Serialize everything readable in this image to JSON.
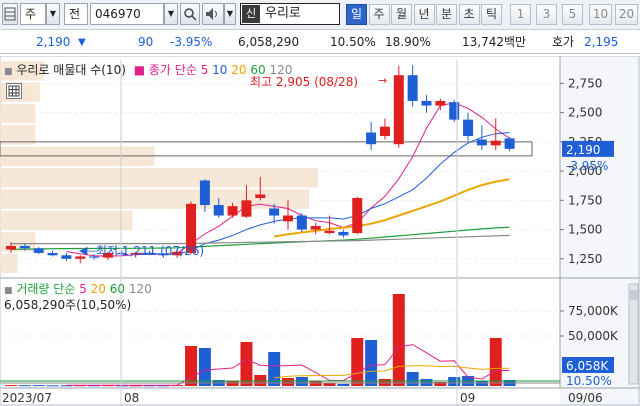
{
  "toolbar": {
    "type_label": "주",
    "market_label": "전",
    "code": "046970",
    "search_icon": "magnifier-icon",
    "brand_badge": "신",
    "name": "우리로",
    "periods": [
      {
        "label": "일",
        "active": true
      },
      {
        "label": "주",
        "active": false
      },
      {
        "label": "월",
        "active": false
      },
      {
        "label": "년",
        "active": false
      },
      {
        "label": "분",
        "active": false
      },
      {
        "label": "초",
        "active": false
      },
      {
        "label": "틱",
        "active": false
      }
    ],
    "numbers": [
      "1",
      "3",
      "5",
      "10",
      "20"
    ]
  },
  "quote": {
    "price": "2,190",
    "change": "90",
    "change_pct": "-3.95%",
    "volume": "6,058,290",
    "vol_ratio": "10.50%",
    "turnover": "18.90%",
    "amount": "13,742백만",
    "bid_label": "호가",
    "bid": "2,195"
  },
  "overlay": {
    "price_legend_title": "우리로 매물대 수(10)",
    "ma_title": "종가 단순",
    "ma_periods": [
      "5",
      "10",
      "20",
      "60",
      "120"
    ],
    "high_label": "최고 2,905 (08/28)",
    "low_label": "최저 1,211 (07/26)",
    "vol_legend_title": "거래량 단순",
    "vol_ma_periods": [
      "5",
      "20",
      "60",
      "120"
    ],
    "vol_value": "6,058,290주(10,50%)",
    "price_tag": "2,190",
    "pct_tag": "-3.95%",
    "vol_tag": "6,058K",
    "vol_pct_tag": "10.50%"
  },
  "colors": {
    "up": "#e01f1f",
    "down": "#1f5fd6",
    "ma5": "#e0208c",
    "ma10": "#1f5fd6",
    "ma20": "#e8a800",
    "ma60": "#1f9e3a",
    "ma120": "#8a8a8a",
    "volume_profile": "#f4e3d0"
  },
  "chart_data": {
    "type": "candlestick",
    "price_axis": {
      "ticks": [
        1250,
        1500,
        1750,
        2000,
        2250,
        2500,
        2750
      ],
      "labels": [
        "1,250",
        "1,500",
        "1,750",
        "2,000",
        "2,250",
        "2,500",
        "2,750"
      ],
      "range": [
        1120,
        2950
      ]
    },
    "volume_axis": {
      "ticks": [
        50000,
        75000
      ],
      "labels": [
        "50,000K",
        "75,000K"
      ],
      "range": [
        0,
        100000
      ]
    },
    "x_labels": [
      "2023/07",
      "08",
      "09",
      "09/06"
    ],
    "candles": [
      {
        "o": 1330,
        "h": 1390,
        "l": 1300,
        "c": 1360,
        "v": 900
      },
      {
        "o": 1360,
        "h": 1380,
        "l": 1320,
        "c": 1340,
        "v": 800
      },
      {
        "o": 1340,
        "h": 1350,
        "l": 1290,
        "c": 1300,
        "v": 900
      },
      {
        "o": 1300,
        "h": 1320,
        "l": 1270,
        "c": 1280,
        "v": 700
      },
      {
        "o": 1280,
        "h": 1300,
        "l": 1230,
        "c": 1250,
        "v": 700
      },
      {
        "o": 1250,
        "h": 1280,
        "l": 1211,
        "c": 1270,
        "v": 800
      },
      {
        "o": 1270,
        "h": 1290,
        "l": 1240,
        "c": 1260,
        "v": 700
      },
      {
        "o": 1260,
        "h": 1310,
        "l": 1240,
        "c": 1300,
        "v": 800
      },
      {
        "o": 1300,
        "h": 1320,
        "l": 1270,
        "c": 1290,
        "v": 700
      },
      {
        "o": 1290,
        "h": 1310,
        "l": 1260,
        "c": 1300,
        "v": 700
      },
      {
        "o": 1300,
        "h": 1320,
        "l": 1280,
        "c": 1290,
        "v": 700
      },
      {
        "o": 1290,
        "h": 1300,
        "l": 1260,
        "c": 1280,
        "v": 700
      },
      {
        "o": 1280,
        "h": 1320,
        "l": 1260,
        "c": 1310,
        "v": 900
      },
      {
        "o": 1300,
        "h": 1740,
        "l": 1290,
        "c": 1720,
        "v": 40000
      },
      {
        "o": 1920,
        "h": 1930,
        "l": 1650,
        "c": 1710,
        "v": 38000
      },
      {
        "o": 1710,
        "h": 1770,
        "l": 1600,
        "c": 1620,
        "v": 6000
      },
      {
        "o": 1620,
        "h": 1730,
        "l": 1600,
        "c": 1700,
        "v": 5000
      },
      {
        "o": 1610,
        "h": 1880,
        "l": 1600,
        "c": 1750,
        "v": 44000
      },
      {
        "o": 1770,
        "h": 1950,
        "l": 1750,
        "c": 1800,
        "v": 11000
      },
      {
        "o": 1680,
        "h": 1720,
        "l": 1550,
        "c": 1620,
        "v": 34000
      },
      {
        "o": 1570,
        "h": 1750,
        "l": 1500,
        "c": 1620,
        "v": 8000
      },
      {
        "o": 1620,
        "h": 1640,
        "l": 1480,
        "c": 1500,
        "v": 9000
      },
      {
        "o": 1500,
        "h": 1560,
        "l": 1460,
        "c": 1530,
        "v": 5000
      },
      {
        "o": 1470,
        "h": 1620,
        "l": 1460,
        "c": 1490,
        "v": 3000
      },
      {
        "o": 1480,
        "h": 1500,
        "l": 1430,
        "c": 1450,
        "v": 2000
      },
      {
        "o": 1470,
        "h": 1780,
        "l": 1460,
        "c": 1770,
        "v": 48000
      },
      {
        "o": 2330,
        "h": 2420,
        "l": 2180,
        "c": 2230,
        "v": 46000
      },
      {
        "o": 2300,
        "h": 2450,
        "l": 2270,
        "c": 2380,
        "v": 7000
      },
      {
        "o": 2230,
        "h": 2900,
        "l": 2200,
        "c": 2820,
        "v": 92000
      },
      {
        "o": 2820,
        "h": 2905,
        "l": 2550,
        "c": 2600,
        "v": 14000
      },
      {
        "o": 2600,
        "h": 2650,
        "l": 2500,
        "c": 2560,
        "v": 7000
      },
      {
        "o": 2560,
        "h": 2620,
        "l": 2520,
        "c": 2600,
        "v": 4000
      },
      {
        "o": 2590,
        "h": 2610,
        "l": 2420,
        "c": 2440,
        "v": 9000
      },
      {
        "o": 2440,
        "h": 2500,
        "l": 2260,
        "c": 2300,
        "v": 10000
      },
      {
        "o": 2270,
        "h": 2390,
        "l": 2180,
        "c": 2220,
        "v": 5000
      },
      {
        "o": 2220,
        "h": 2450,
        "l": 2180,
        "c": 2260,
        "v": 48000
      },
      {
        "o": 2280,
        "h": 2290,
        "l": 2170,
        "c": 2190,
        "v": 6058
      }
    ],
    "ma_series": [
      {
        "name": "5",
        "values": [
          null,
          null,
          null,
          null,
          1312,
          1292,
          1276,
          1272,
          1276,
          1284,
          1290,
          1290,
          1296,
          1380,
          1462,
          1529,
          1614,
          1700,
          1716,
          1698,
          1680,
          1620,
          1576,
          1558,
          1518,
          1558,
          1684,
          1784,
          1934,
          2122,
          2366,
          2560,
          2584,
          2536,
          2460,
          2360,
          2280
        ]
      },
      {
        "name": "10",
        "values": [
          null,
          null,
          null,
          null,
          null,
          null,
          null,
          null,
          null,
          1296,
          1297,
          1290,
          1290,
          1320,
          1380,
          1410,
          1450,
          1500,
          1540,
          1570,
          1590,
          1600,
          1600,
          1600,
          1590,
          1620,
          1680,
          1720,
          1780,
          1840,
          1940,
          2060,
          2160,
          2240,
          2290,
          2320,
          2330
        ]
      },
      {
        "name": "20",
        "values": [
          null,
          null,
          null,
          null,
          null,
          null,
          null,
          null,
          null,
          null,
          null,
          null,
          null,
          null,
          null,
          null,
          null,
          null,
          null,
          1440,
          1460,
          1475,
          1490,
          1505,
          1515,
          1530,
          1550,
          1580,
          1620,
          1660,
          1700,
          1740,
          1790,
          1840,
          1880,
          1910,
          1930
        ]
      },
      {
        "name": "60",
        "values": [
          1330,
          1332,
          1334,
          1336,
          1337,
          1338,
          1338,
          1339,
          1340,
          1340,
          1341,
          1342,
          1344,
          1350,
          1356,
          1362,
          1368,
          1374,
          1380,
          1385,
          1390,
          1395,
          1400,
          1405,
          1410,
          1418,
          1426,
          1436,
          1446,
          1456,
          1466,
          1476,
          1486,
          1496,
          1506,
          1514,
          1520
        ]
      },
      {
        "name": "120",
        "values": [
          1380,
          1380,
          1380,
          1380,
          1380,
          1380,
          1380,
          1380,
          1380,
          1380,
          1380,
          1380,
          1380,
          1382,
          1384,
          1386,
          1388,
          1390,
          1392,
          1394,
          1396,
          1398,
          1400,
          1402,
          1404,
          1406,
          1410,
          1414,
          1418,
          1422,
          1426,
          1430,
          1434,
          1438,
          1442,
          1446,
          1450
        ]
      }
    ],
    "volume_ma_series": [
      {
        "name": "5",
        "values": [
          null,
          null,
          null,
          null,
          800,
          780,
          760,
          740,
          740,
          740,
          720,
          720,
          760,
          8600,
          16000,
          17000,
          18000,
          26600,
          20800,
          20000,
          20400,
          21000,
          13400,
          5600,
          5400,
          13400,
          20800,
          21200,
          39000,
          41400,
          33200,
          24800,
          25200,
          8800,
          7000,
          15200,
          15600
        ]
      },
      {
        "name": "20",
        "values": [
          null,
          null,
          null,
          null,
          null,
          null,
          null,
          null,
          null,
          null,
          null,
          null,
          null,
          null,
          null,
          null,
          null,
          null,
          null,
          8000,
          9800,
          10200,
          10400,
          10600,
          10600,
          12600,
          14800,
          15100,
          19600,
          20300,
          20200,
          19500,
          19700,
          18000,
          16600,
          17600,
          17700
        ]
      }
    ]
  }
}
